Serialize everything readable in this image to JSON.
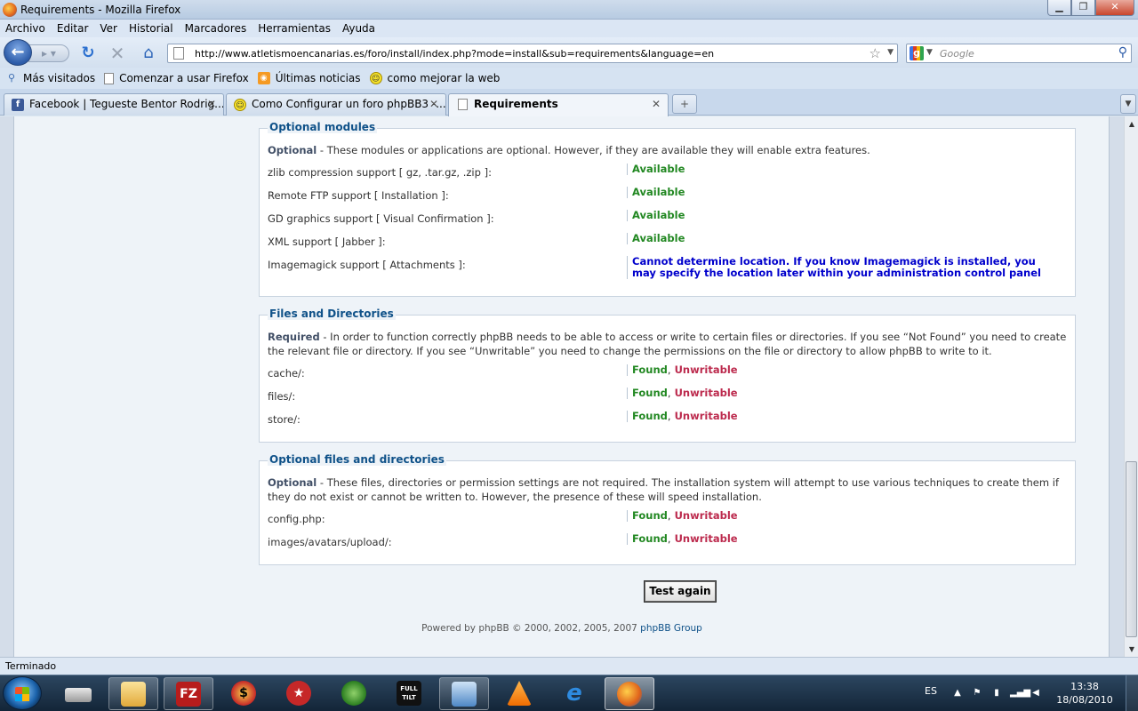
{
  "window": {
    "title": "Requirements - Mozilla Firefox"
  },
  "menubar": {
    "items": [
      "Archivo",
      "Editar",
      "Ver",
      "Historial",
      "Marcadores",
      "Herramientas",
      "Ayuda"
    ]
  },
  "navbar": {
    "url": "http://www.atletismoencanarias.es/foro/install/index.php?mode=install&sub=requirements&language=en",
    "search_placeholder": "Google",
    "search_engine_icon": "google-icon"
  },
  "bookmarks": [
    {
      "label": "Más visitados",
      "icon": "most-visited-icon"
    },
    {
      "label": "Comenzar a usar Firefox",
      "icon": "page-icon"
    },
    {
      "label": "Últimas noticias",
      "icon": "rss-icon"
    },
    {
      "label": "como mejorar la web",
      "icon": "smiley-icon"
    }
  ],
  "tabs": [
    {
      "label": "Facebook | Tegueste Bentor Rodrig...",
      "icon": "facebook-icon"
    },
    {
      "label": "Como Configurar un foro phpBB3 -...",
      "icon": "smiley-icon"
    },
    {
      "label": "Requirements",
      "icon": "page-icon",
      "active": true
    }
  ],
  "content": {
    "optional_modules": {
      "legend": "Optional modules",
      "desc_strong": "Optional",
      "desc_text": " - These modules or applications are optional. However, if they are available they will enable extra features.",
      "rows": [
        {
          "label": "zlib compression support [ gz, .tar.gz, .zip ]:",
          "value": "Available"
        },
        {
          "label": "Remote FTP support [ Installation ]:",
          "value": "Available"
        },
        {
          "label": "GD graphics support [ Visual Confirmation ]:",
          "value": "Available"
        },
        {
          "label": "XML support [ Jabber ]:",
          "value": "Available"
        },
        {
          "label": "Imagemagick support [ Attachments ]:",
          "value_line1": "Cannot determine location. If you know Imagemagick is installed, you",
          "value_line2": "may specify the location later within your administration control panel"
        }
      ]
    },
    "files_dirs": {
      "legend": "Files and Directories",
      "desc_strong": "Required",
      "desc_text": " - In order to function correctly phpBB needs to be able to access or write to certain files or directories. If you see “Not Found” you need to create the relevant file or directory. If you see “Unwritable” you need to change the permissions on the file or directory to allow phpBB to write to it.",
      "rows": [
        {
          "label": "cache/:",
          "found": "Found",
          "sep": ",",
          "writable": "Unwritable"
        },
        {
          "label": "files/:",
          "found": "Found",
          "sep": ",",
          "writable": "Unwritable"
        },
        {
          "label": "store/:",
          "found": "Found",
          "sep": ",",
          "writable": "Unwritable"
        }
      ]
    },
    "optional_files": {
      "legend": "Optional files and directories",
      "desc_strong": "Optional",
      "desc_text": " - These files, directories or permission settings are not required. The installation system will attempt to use various techniques to create them if they do not exist or cannot be written to. However, the presence of these will speed installation.",
      "rows": [
        {
          "label": "config.php:",
          "found": "Found",
          "sep": ",",
          "writable": "Unwritable"
        },
        {
          "label": "images/avatars/upload/:",
          "found": "Found",
          "sep": ",",
          "writable": "Unwritable"
        }
      ]
    },
    "test_again": "Test again",
    "footer_text": "Powered by phpBB © 2000, 2002, 2005, 2007 ",
    "footer_link": "phpBB Group"
  },
  "statusbar": {
    "text": "Terminado"
  },
  "taskbar": {
    "items": [
      {
        "icon": "drive-icon"
      },
      {
        "icon": "explorer-icon"
      },
      {
        "icon": "filezilla-icon",
        "glyph": "FZ"
      },
      {
        "icon": "poker-icon"
      },
      {
        "icon": "pokerstars-icon"
      },
      {
        "icon": "messenger-icon"
      },
      {
        "icon": "fulltilt-icon",
        "glyph": "FULL TILT"
      },
      {
        "icon": "window-icon"
      },
      {
        "icon": "vlc-icon"
      },
      {
        "icon": "ie-icon",
        "glyph": "e"
      },
      {
        "icon": "firefox-icon",
        "active": true
      }
    ],
    "tray": {
      "language": "ES",
      "time": "13:38",
      "date": "18/08/2010"
    }
  },
  "colors": {
    "available": "#228822",
    "unwritable": "#bc2a4d",
    "imagemagick": "#0000cc",
    "legend": "#105289"
  }
}
